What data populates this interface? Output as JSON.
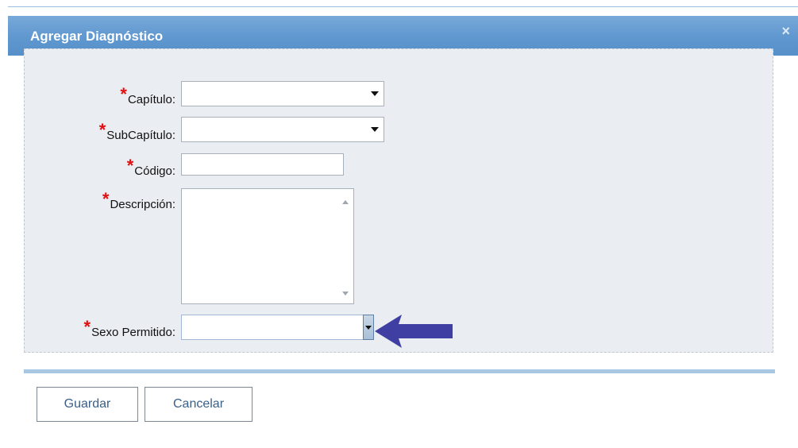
{
  "dialog": {
    "title": "Agregar Diagnóstico",
    "close_icon": "×"
  },
  "form": {
    "required_mark": "*",
    "capitulo": {
      "label": "Capítulo:",
      "value": ""
    },
    "subcapitulo": {
      "label": "SubCapítulo:",
      "value": ""
    },
    "codigo": {
      "label": "Código:",
      "value": ""
    },
    "descripcion": {
      "label": "Descripción:",
      "value": ""
    },
    "sexo": {
      "label": "Sexo Permitido:",
      "value": ""
    }
  },
  "buttons": {
    "save": "Guardar",
    "cancel": "Cancelar"
  },
  "colors": {
    "titlebar": "#5f97cf",
    "required": "#e01010",
    "arrow": "#3f3fa3",
    "panel": "#eaedf2"
  },
  "icons": {
    "close": "close-icon",
    "dropdown": "chevron-down-icon",
    "annotation": "arrow-left-icon"
  }
}
